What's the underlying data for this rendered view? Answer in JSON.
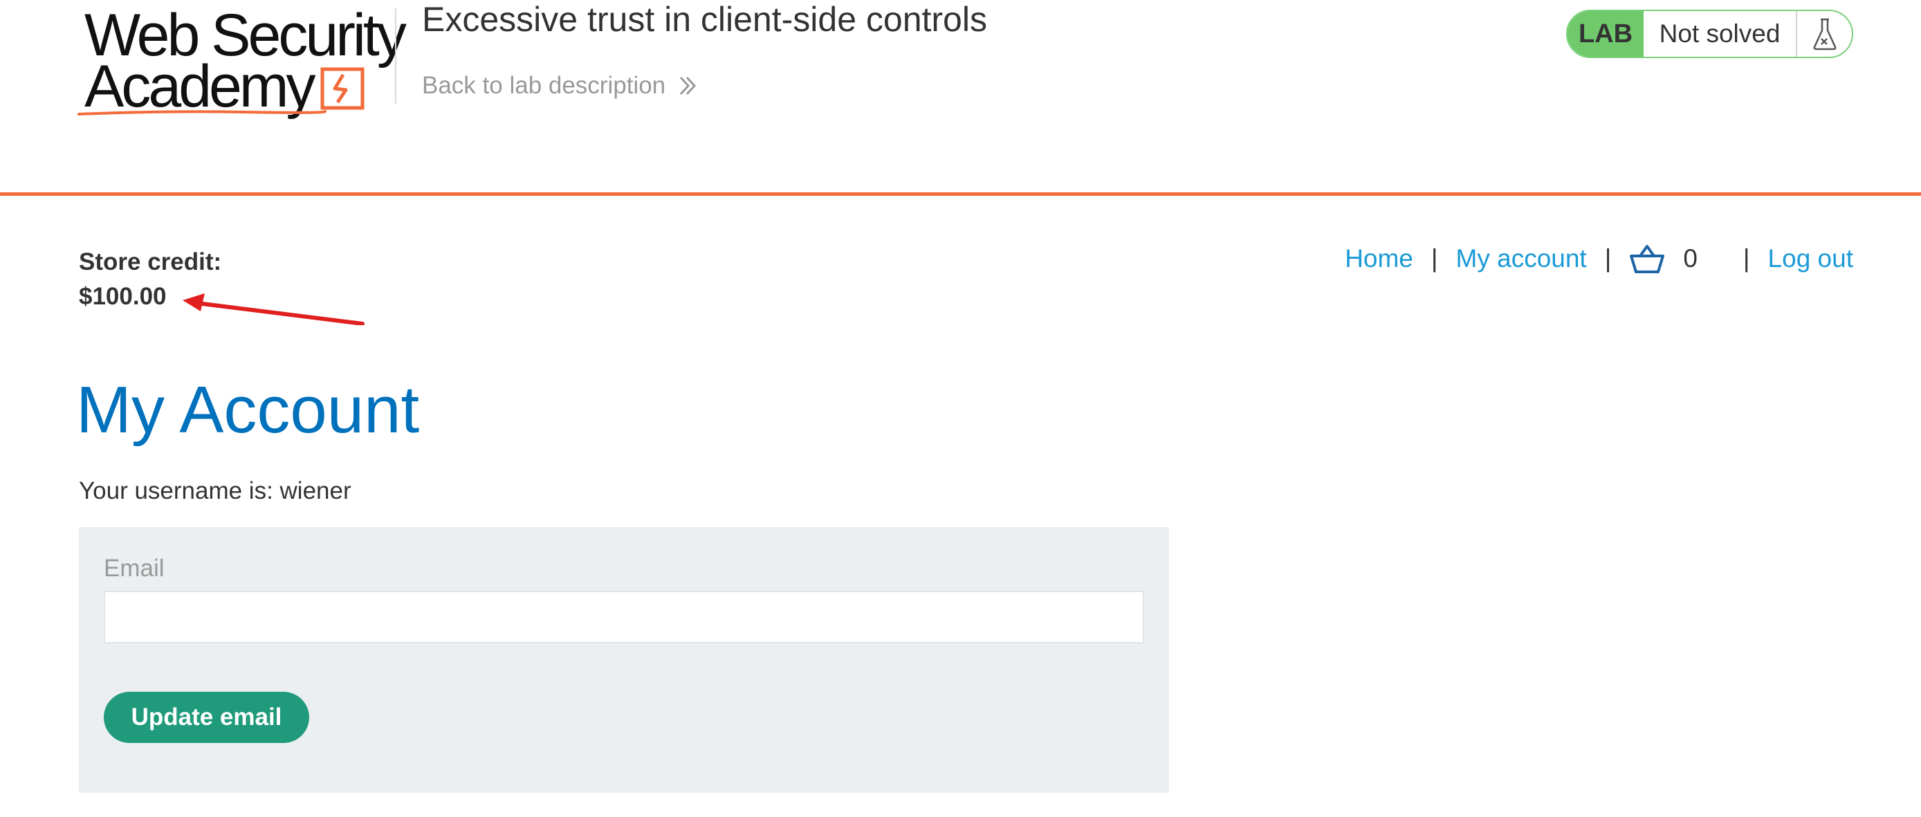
{
  "header": {
    "logo": {
      "line1": "Web Security",
      "line2": "Academy"
    },
    "lab_title": "Excessive trust in client-side controls",
    "back_link": "Back to lab description",
    "lab_badge": {
      "tag": "LAB",
      "status": "Not solved",
      "icon": "flask-icon"
    }
  },
  "account_info": {
    "store_credit_label": "Store credit:",
    "store_credit_value": "$100.00"
  },
  "nav": {
    "home": "Home",
    "my_account": "My account",
    "separator": "|",
    "cart_icon": "cart-icon",
    "cart_count": "0",
    "log_out": "Log out"
  },
  "main": {
    "title": "My Account",
    "username_text": "Your username is: wiener",
    "form": {
      "email_label": "Email",
      "email_value": "",
      "update_button": "Update email"
    }
  },
  "colors": {
    "accent_orange": "#f26b3a",
    "link_blue": "#1a9ad6",
    "title_blue": "#0071bc",
    "button_green": "#1f9a7a",
    "lab_green": "#70c96b",
    "annotation_red": "#e02020"
  }
}
